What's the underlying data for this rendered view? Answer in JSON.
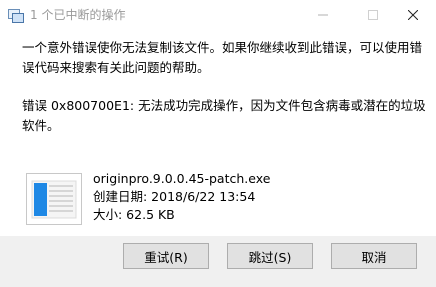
{
  "window": {
    "title": "1 个已中断的操作"
  },
  "message": {
    "line1": "一个意外错误使你无法复制该文件。如果你继续收到此错误，可以使用错误代码来搜索有关此问题的帮助。",
    "line2": "错误 0x800700E1: 无法成功完成操作，因为文件包含病毒或潜在的垃圾软件。"
  },
  "file": {
    "name": "originpro.9.0.0.45-patch.exe",
    "created": "创建日期: 2018/6/22 13:54",
    "size": "大小: 62.5 KB"
  },
  "buttons": {
    "retry": "重试(R)",
    "skip": "跳过(S)",
    "cancel": "取消"
  },
  "icons": {
    "app": "copy-icon",
    "minimize": "minimize-icon",
    "maximize": "maximize-icon",
    "close": "close-icon",
    "file": "file-thumbnail-icon"
  },
  "colors": {
    "title_text": "#9a9a9a",
    "footer_bg": "#f0f0f0",
    "button_bg": "#e1e1e1",
    "accent": "#1e88e5"
  }
}
